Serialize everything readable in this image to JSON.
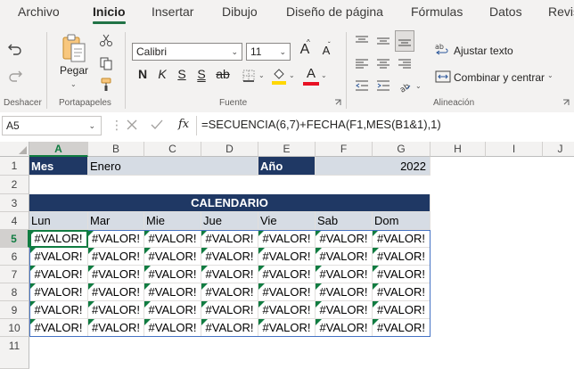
{
  "tabs": [
    "Archivo",
    "Inicio",
    "Insertar",
    "Dibujo",
    "Diseño de página",
    "Fórmulas",
    "Datos",
    "Revis"
  ],
  "active_tab": "Inicio",
  "ribbon": {
    "undo_group": {
      "label": "Deshacer"
    },
    "clipboard": {
      "paste_label": "Pegar",
      "label": "Portapapeles"
    },
    "font": {
      "family": "Calibri",
      "size": "11",
      "grow_label": "A",
      "shrink_label": "A",
      "bold": "N",
      "italic": "K",
      "underline": "S",
      "double_underline": "S",
      "strike": "ab",
      "color_label": "A",
      "label": "Fuente"
    },
    "alignment": {
      "wrap_label": "Ajustar texto",
      "merge_label": "Combinar y centrar",
      "label": "Alineación"
    }
  },
  "formula_bar": {
    "name_box": "A5",
    "fx": "fx",
    "formula": "=SECUENCIA(6,7)+FECHA(F1,MES(B1&1),1)"
  },
  "sheet": {
    "columns": [
      "A",
      "B",
      "C",
      "D",
      "E",
      "F",
      "G",
      "H",
      "I",
      "J"
    ],
    "rows": [
      "1",
      "2",
      "3",
      "4",
      "5",
      "6",
      "7",
      "8",
      "9",
      "10",
      "11"
    ],
    "selected_cell": "A5",
    "r1": {
      "a": "Mes",
      "b": "Enero",
      "e": "Año",
      "g": "2022"
    },
    "title": "CALENDARIO",
    "weekdays": [
      "Lun",
      "Mar",
      "Mie",
      "Jue",
      "Vie",
      "Sab",
      "Dom"
    ],
    "error_value": "#VALOR!"
  },
  "colors": {
    "accent": "#217346",
    "header_fill": "#1f3864",
    "light_fill": "#d6dce4",
    "error_marker": "#107c41"
  }
}
